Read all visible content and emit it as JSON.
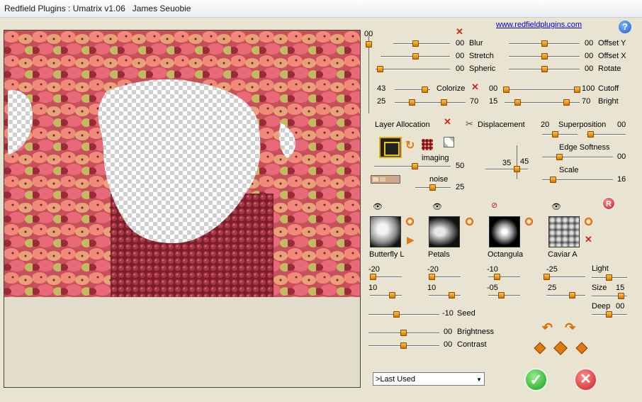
{
  "window": {
    "title": "Redfield Plugins : Umatrix v1.06   James Seuobie"
  },
  "header": {
    "website": "www.redfieldplugins.com",
    "help_label": "?",
    "top_value": "00"
  },
  "sliders_top": [
    {
      "key": "blur",
      "label": "Blur",
      "value": "00"
    },
    {
      "key": "stretch",
      "label": "Stretch",
      "value": "00"
    },
    {
      "key": "spheric",
      "label": "Spheric",
      "value": "00"
    },
    {
      "key": "offset_y",
      "label": "Offset Y",
      "value": "00"
    },
    {
      "key": "offset_x",
      "label": "Offset X",
      "value": "00"
    },
    {
      "key": "rotate",
      "label": "Rotate",
      "value": "00"
    }
  ],
  "colorize": {
    "label": "Colorize",
    "value": "43"
  },
  "range_left": {
    "min": "25",
    "max": "70"
  },
  "cutoff": {
    "label": "Cutoff",
    "min": "00",
    "max": "100"
  },
  "bright": {
    "label": "Bright",
    "min": "15",
    "max": "70"
  },
  "layer_allocation": {
    "label": "Layer Allocation"
  },
  "imaging": {
    "label": "imaging",
    "value": "50"
  },
  "noise": {
    "label": "noise",
    "value": "25"
  },
  "displacement": {
    "label": "Displacement",
    "value_a": "35",
    "value_b": "45"
  },
  "superposition": {
    "label": "Superposition",
    "value_left": "20",
    "value_right": "00"
  },
  "edge_softness": {
    "label": "Edge Softness",
    "value": "00"
  },
  "scale": {
    "label": "Scale",
    "value": "16"
  },
  "layers": [
    {
      "name": "Butterfly L",
      "v1": "-20",
      "v2": "10"
    },
    {
      "name": "Petals",
      "v1": "-20",
      "v2": "10"
    },
    {
      "name": "Octangula",
      "v1": "-10",
      "v2": "-05"
    },
    {
      "name": "Caviar A",
      "v1": "-25",
      "v2": "25"
    }
  ],
  "light": {
    "label": "Light"
  },
  "size": {
    "label": "Size",
    "value": "15"
  },
  "deep": {
    "label": "Deep",
    "value": "00"
  },
  "seed": {
    "label": "Seed",
    "value": "-10"
  },
  "brightness": {
    "label": "Brightness",
    "value": "00"
  },
  "contrast": {
    "label": "Contrast",
    "value": "00"
  },
  "preset": {
    "selected": ">Last Used"
  },
  "buttons": {
    "ok": "✓",
    "cancel": "✕",
    "reset": "R"
  },
  "colors": {
    "accent": "#e08a10",
    "background": "#e9e3d2",
    "close": "#d02424"
  }
}
